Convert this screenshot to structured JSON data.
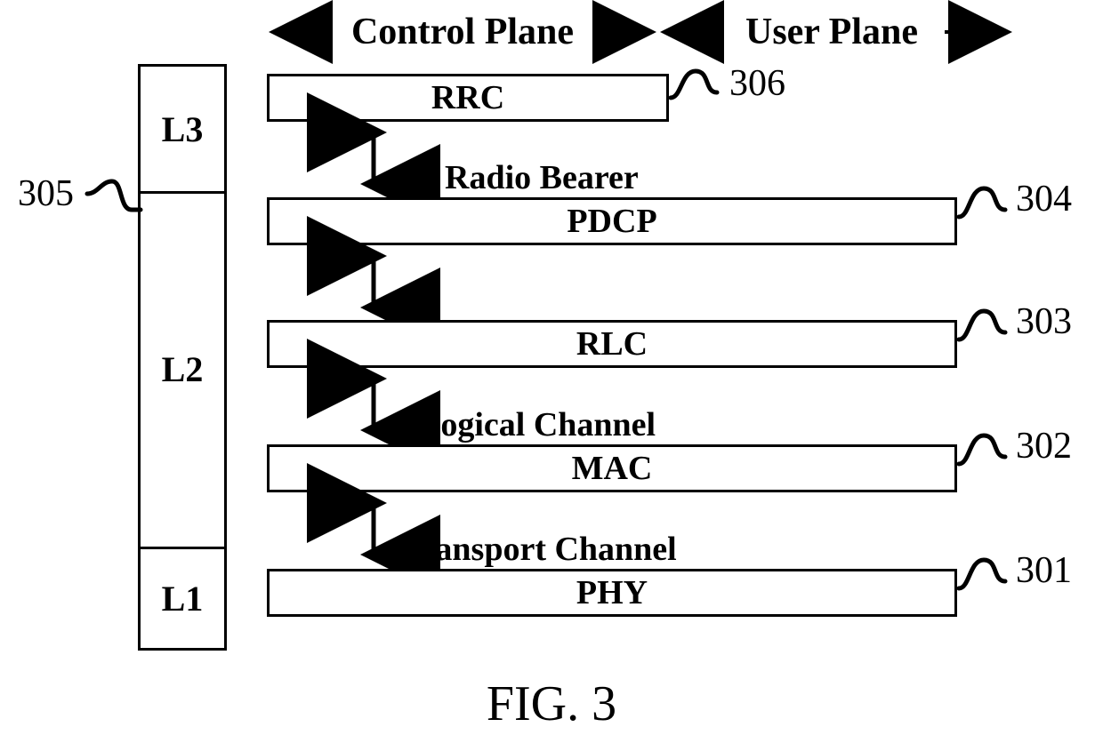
{
  "header": {
    "control_plane": "Control Plane",
    "user_plane": "User Plane"
  },
  "layer_col": {
    "L3": "L3",
    "L2": "L2",
    "L1": "L1",
    "ref305": "305"
  },
  "blocks": {
    "rrc": {
      "label": "RRC",
      "ref": "306"
    },
    "pdcp": {
      "label": "PDCP",
      "ref": "304",
      "above": "Radio Bearer"
    },
    "rlc": {
      "label": "RLC",
      "ref": "303"
    },
    "mac": {
      "label": "MAC",
      "ref": "302",
      "above": "Logical Channel"
    },
    "phy": {
      "label": "PHY",
      "ref": "301",
      "above": "Transport Channel"
    }
  },
  "figure_caption": "FIG. 3"
}
